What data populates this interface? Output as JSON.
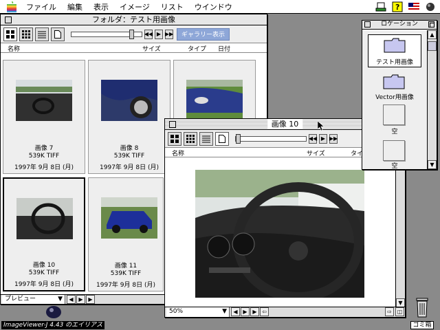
{
  "menubar": {
    "items": [
      "ファイル",
      "編集",
      "表示",
      "イメージ",
      "リスト",
      "ウインドウ"
    ]
  },
  "folder_window": {
    "title": "フォルダ：テスト用画像",
    "gallery_button": "ギャラリー表示",
    "columns": {
      "name": "名称",
      "size": "サイズ",
      "type": "タイプ",
      "date": "日付"
    },
    "items": [
      {
        "name": "画像 7",
        "info": "539K  TIFF",
        "date": "1997年 9月 8日 (月)"
      },
      {
        "name": "画像 8",
        "info": "539K  TIFF",
        "date": "1997年 9月 8日 (月)"
      },
      {
        "name": "画像 10",
        "info": "539K  TIFF",
        "date": "1997年 9月 8日 (月)"
      },
      {
        "name": "画像 11",
        "info": "539K  TIFF",
        "date": "1997年 9月 8日 (月)"
      }
    ],
    "preview_select": "プレビュー"
  },
  "image_window": {
    "title": "画像 10",
    "columns": {
      "name": "名称",
      "size": "サイズ",
      "type": "タイプ"
    },
    "zoom": "50%"
  },
  "location_window": {
    "title": "ロケーション",
    "items": [
      "テスト用画像",
      "Vector用画像",
      "空",
      "空"
    ]
  },
  "desktop": {
    "trash_label": "ゴミ箱",
    "alias_label": "ImageViewer-J 4.43 のエイリアス"
  },
  "colors": {
    "gallery_blue": "#8ea7d8",
    "desktop_gray": "#8a8a8a",
    "folder_blue": "#c7c7f0"
  }
}
